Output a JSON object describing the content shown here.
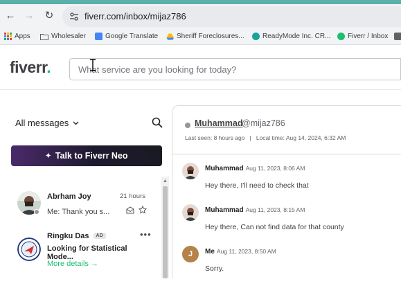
{
  "browser": {
    "url": "fiverr.com/inbox/mijaz786",
    "bookmarks": [
      {
        "label": "Apps"
      },
      {
        "label": "Wholesaler"
      },
      {
        "label": "Google Translate"
      },
      {
        "label": "Sheriff Foreclosures..."
      },
      {
        "label": "ReadyMode Inc. CR..."
      },
      {
        "label": "Fiverr / Inbox"
      }
    ]
  },
  "header": {
    "logo": "fiverr",
    "logo_dot": ".",
    "search_placeholder": "What service are you looking for today?"
  },
  "sidebar": {
    "filter_label": "All messages",
    "neo_button": "Talk to Fiverr Neo",
    "conversations": [
      {
        "name": "Abrham Joy",
        "time": "21 hours",
        "preview": "Me: Thank you s..."
      },
      {
        "name": "Ringku Das",
        "badge": "AD",
        "preview": "Looking for Statistical Mode...",
        "link": "More details →"
      }
    ]
  },
  "chat": {
    "contact_name": "Muhammad",
    "contact_username": "@mijaz786",
    "meta": "Last seen: 8 hours ago   |   Local time: Aug 14, 2024, 6:32 AM",
    "messages": [
      {
        "author": "Muhammad",
        "time": "Aug 11, 2023, 8:06 AM",
        "text": "Hey there, I'll need to check that"
      },
      {
        "author": "Muhammad",
        "time": "Aug 11, 2023, 8:15 AM",
        "text": "Hey there, Can not find data for that county"
      },
      {
        "author": "Me",
        "avatar_letter": "J",
        "time": "Aug 11, 2023, 8:50 AM",
        "text": "Sorry."
      }
    ]
  }
}
